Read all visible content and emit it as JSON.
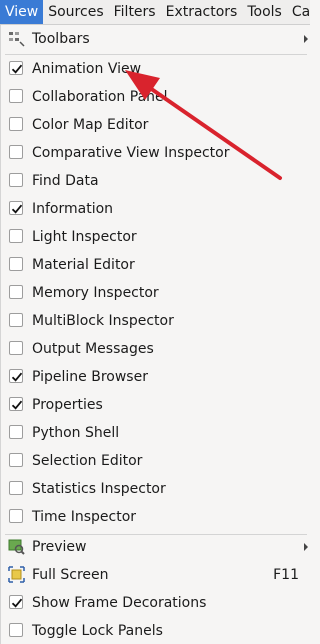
{
  "menubar": {
    "items": [
      {
        "label": "View",
        "active": true
      },
      {
        "label": "Sources"
      },
      {
        "label": "Filters"
      },
      {
        "label": "Extractors"
      },
      {
        "label": "Tools"
      },
      {
        "label": "Catalyst"
      }
    ]
  },
  "menu": {
    "toolbars_label": "Toolbars",
    "panels": [
      {
        "label": "Animation View",
        "checked": true
      },
      {
        "label": "Collaboration Panel",
        "checked": false
      },
      {
        "label": "Color Map Editor",
        "checked": false
      },
      {
        "label": "Comparative View Inspector",
        "checked": false
      },
      {
        "label": "Find Data",
        "checked": false
      },
      {
        "label": "Information",
        "checked": true
      },
      {
        "label": "Light Inspector",
        "checked": false
      },
      {
        "label": "Material Editor",
        "checked": false
      },
      {
        "label": "Memory Inspector",
        "checked": false
      },
      {
        "label": "MultiBlock Inspector",
        "checked": false
      },
      {
        "label": "Output Messages",
        "checked": false
      },
      {
        "label": "Pipeline Browser",
        "checked": true
      },
      {
        "label": "Properties",
        "checked": true
      },
      {
        "label": "Python Shell",
        "checked": false
      },
      {
        "label": "Selection Editor",
        "checked": false
      },
      {
        "label": "Statistics Inspector",
        "checked": false
      },
      {
        "label": "Time Inspector",
        "checked": false
      }
    ],
    "preview_label": "Preview",
    "fullscreen_label": "Full Screen",
    "fullscreen_shortcut": "F11",
    "frame_decorations_label": "Show Frame Decorations",
    "frame_decorations_checked": true,
    "toggle_lock_label": "Toggle Lock Panels"
  },
  "icons": {
    "toolbars": "toolbars-icon",
    "preview": "preview-icon",
    "fullscreen": "fullscreen-icon",
    "checkbox": "checkmark-icon"
  },
  "colors": {
    "menubar_active": "#3a7bd5",
    "annotation_arrow": "#d9232d"
  }
}
